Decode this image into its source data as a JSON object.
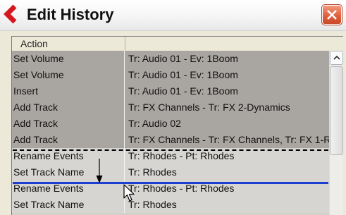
{
  "window": {
    "title": "Edit History"
  },
  "header": {
    "action_label": "Action",
    "description_label": ""
  },
  "rows": [
    {
      "action": "Set Volume",
      "description": "Tr: Audio 01 - Ev: 1Boom",
      "state": "done"
    },
    {
      "action": "Set Volume",
      "description": "Tr: Audio 01 - Ev: 1Boom",
      "state": "done"
    },
    {
      "action": "Insert",
      "description": "Tr: Audio 01 - Ev: 1Boom",
      "state": "done"
    },
    {
      "action": "Add Track",
      "description": "Tr: FX Channels - Tr: FX 2-Dynamics",
      "state": "done"
    },
    {
      "action": "Add Track",
      "description": "Tr: Audio 02",
      "state": "done"
    },
    {
      "action": "Add Track",
      "description": "Tr: FX Channels - Tr: FX Channels, Tr: FX 1-R",
      "state": "done"
    },
    {
      "action": "Rename Events",
      "description": "Tr: Rhodes - Pt: Rhodes",
      "state": "undone"
    },
    {
      "action": "Set Track Name",
      "description": "Tr: Rhodes",
      "state": "undone"
    },
    {
      "action": "Rename Events",
      "description": "Tr: Rhodes - Pt: Rhodes",
      "state": "undone"
    },
    {
      "action": "Set Track Name",
      "description": "Tr: Rhodes",
      "state": "undone"
    }
  ],
  "icons": {
    "app": "steinberg-logo-icon",
    "close": "close-icon",
    "scroll_up": "scroll-up-arrow-icon",
    "drag_marker": "down-arrow-icon",
    "cursor": "mouse-pointer-icon"
  },
  "colors": {
    "done_row": "#a9a6a2",
    "undone_row": "#d7d5d2",
    "undo_marker": "#1d3fd1",
    "close_button": "#e0603e",
    "logo": "#d5181e"
  }
}
